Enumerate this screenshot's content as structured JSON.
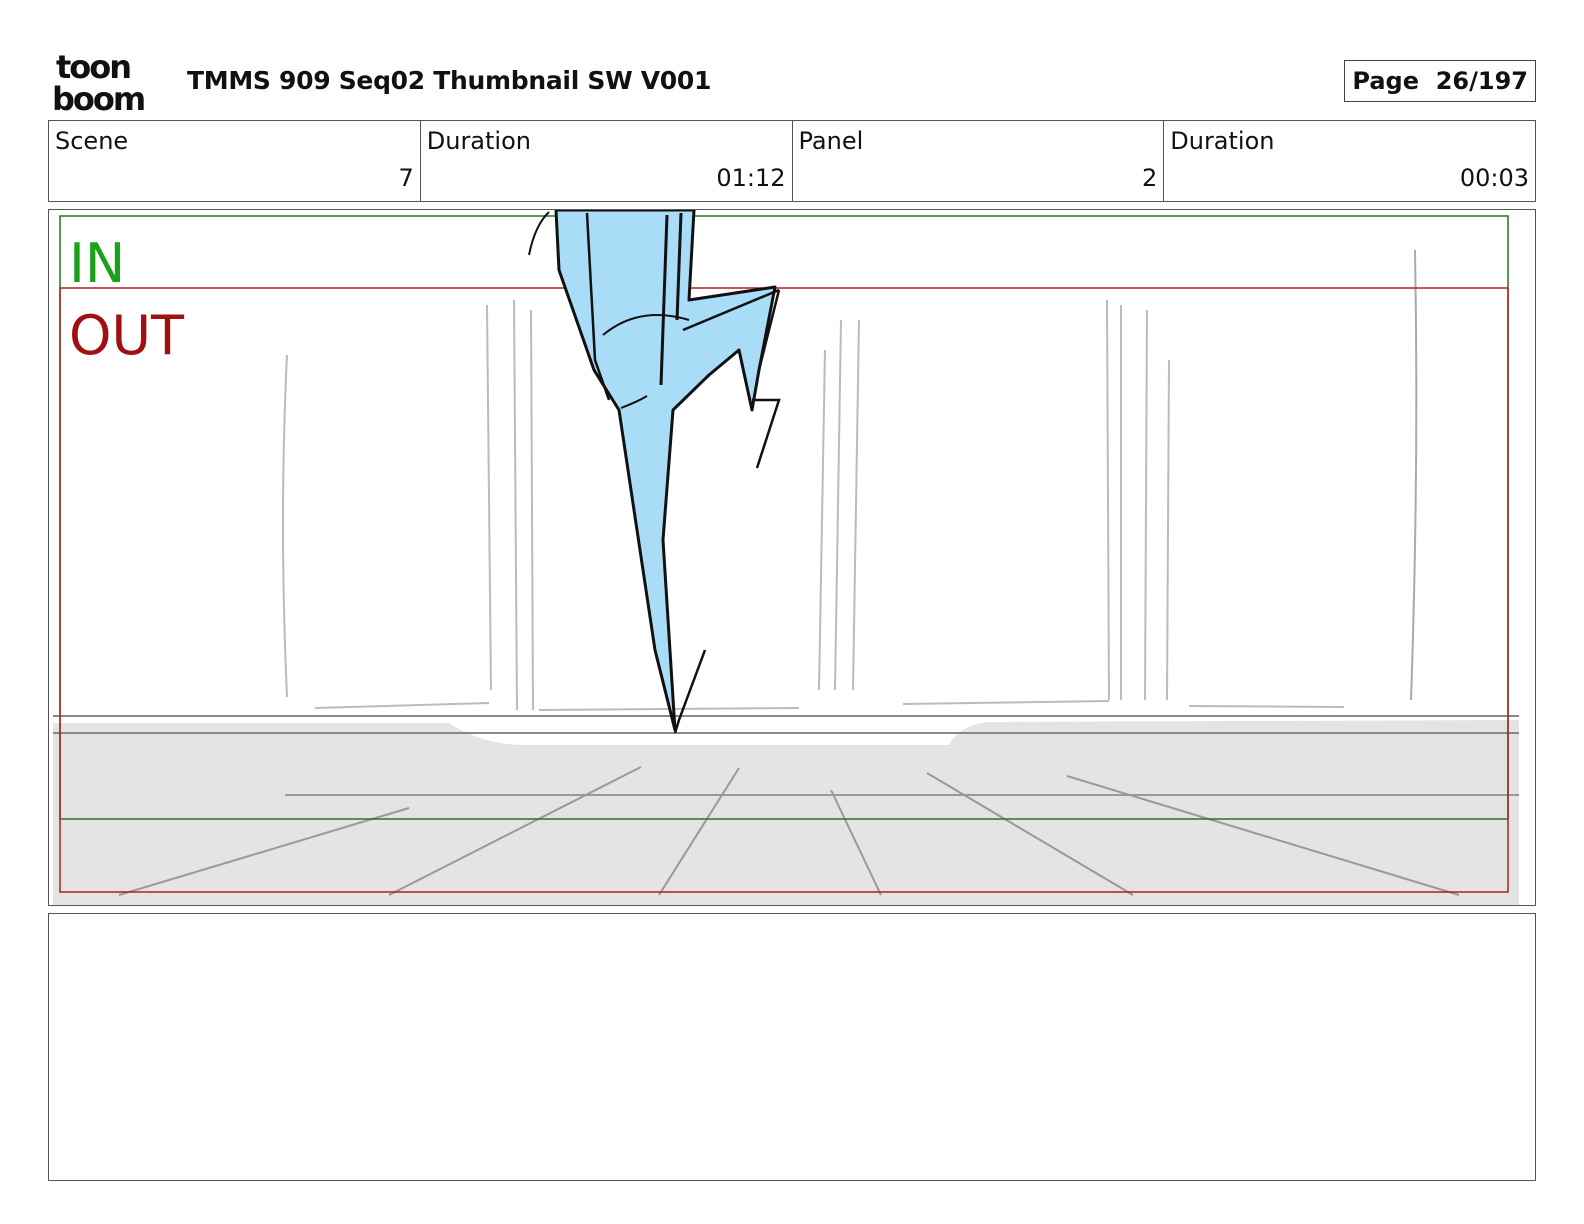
{
  "header": {
    "logo_top": "toon",
    "logo_bottom": "boom",
    "title": "TMMS 909 Seq02 Thumbnail SW V001",
    "page_label": "Page",
    "page_value": "26/197"
  },
  "info": {
    "scene_label": "Scene",
    "scene_value": "7",
    "scene_duration_label": "Duration",
    "scene_duration_value": "01:12",
    "panel_label": "Panel",
    "panel_value": "2",
    "panel_duration_label": "Duration",
    "panel_duration_value": "00:03"
  },
  "frame": {
    "in_label": "IN",
    "out_label": "OUT",
    "in_color": "#1aa01a",
    "out_color": "#a01010",
    "character_fill": "#a8dcf7",
    "floor_fill": "#e4e4e4"
  },
  "notes": {
    "text": ""
  }
}
